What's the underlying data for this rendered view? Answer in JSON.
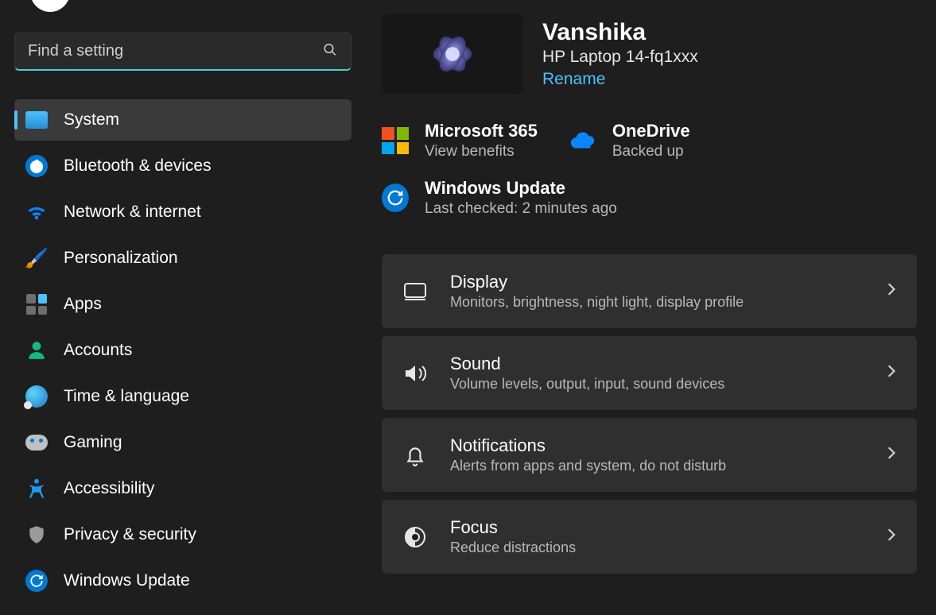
{
  "search": {
    "placeholder": "Find a setting"
  },
  "sidebar": {
    "items": [
      {
        "label": "System"
      },
      {
        "label": "Bluetooth & devices"
      },
      {
        "label": "Network & internet"
      },
      {
        "label": "Personalization"
      },
      {
        "label": "Apps"
      },
      {
        "label": "Accounts"
      },
      {
        "label": "Time & language"
      },
      {
        "label": "Gaming"
      },
      {
        "label": "Accessibility"
      },
      {
        "label": "Privacy & security"
      },
      {
        "label": "Windows Update"
      }
    ]
  },
  "profile": {
    "name": "Vanshika",
    "model": "HP Laptop 14-fq1xxx",
    "rename_label": "Rename"
  },
  "status": {
    "ms365": {
      "title": "Microsoft 365",
      "sub": "View benefits"
    },
    "onedrive": {
      "title": "OneDrive",
      "sub": "Backed up"
    },
    "update": {
      "title": "Windows Update",
      "sub": "Last checked: 2 minutes ago"
    }
  },
  "settings": [
    {
      "title": "Display",
      "sub": "Monitors, brightness, night light, display profile"
    },
    {
      "title": "Sound",
      "sub": "Volume levels, output, input, sound devices"
    },
    {
      "title": "Notifications",
      "sub": "Alerts from apps and system, do not disturb"
    },
    {
      "title": "Focus",
      "sub": "Reduce distractions"
    }
  ]
}
